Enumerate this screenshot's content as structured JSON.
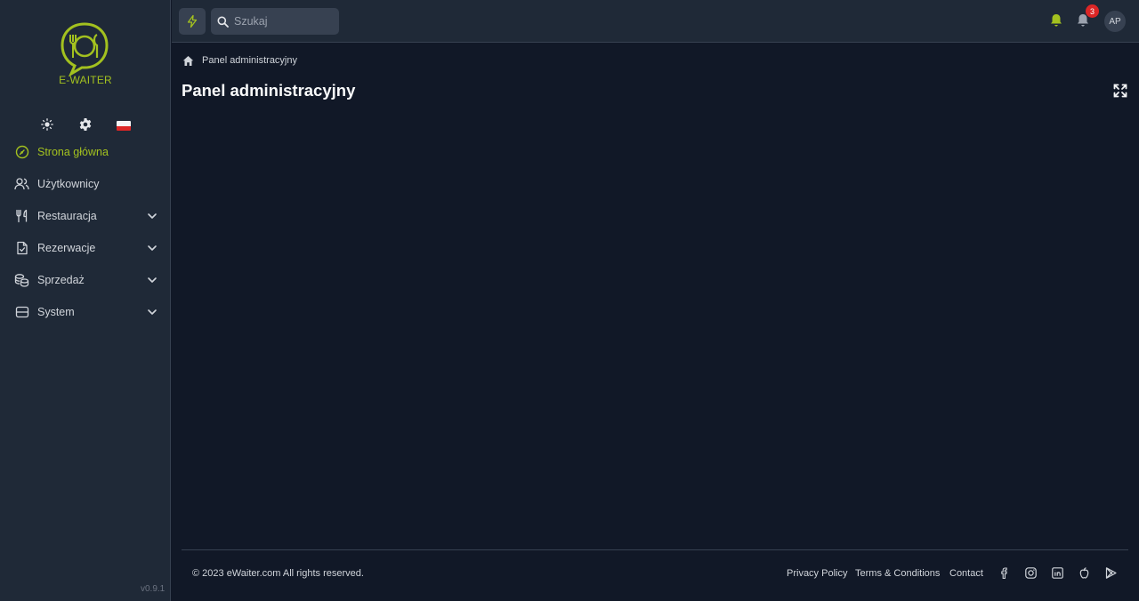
{
  "sidebar": {
    "logo_text": "E-WAITER",
    "quick_icons": [
      "sun-icon",
      "gear-icon",
      "poland-flag-icon"
    ],
    "items": [
      {
        "label": "Strona główna",
        "icon": "dashboard-icon",
        "active": true,
        "expandable": false
      },
      {
        "label": "Użytkownicy",
        "icon": "users-icon",
        "active": false,
        "expandable": false
      },
      {
        "label": "Restauracja",
        "icon": "utensils-icon",
        "active": false,
        "expandable": true
      },
      {
        "label": "Rezerwacje",
        "icon": "document-check-icon",
        "active": false,
        "expandable": true
      },
      {
        "label": "Sprzedaż",
        "icon": "coins-icon",
        "active": false,
        "expandable": true
      },
      {
        "label": "System",
        "icon": "server-icon",
        "active": false,
        "expandable": true
      }
    ],
    "version": "v0.9.1"
  },
  "topbar": {
    "search_placeholder": "Szukaj",
    "notification_count": "3",
    "avatar_initials": "AP"
  },
  "breadcrumb": {
    "current": "Panel administracyjny"
  },
  "main": {
    "title": "Panel administracyjny"
  },
  "footer": {
    "copyright": "© 2023 eWaiter.com All rights reserved.",
    "links": [
      "Privacy Policy",
      "Terms & Conditions",
      "Contact"
    ],
    "social_icons": [
      "facebook-icon",
      "instagram-icon",
      "linkedin-icon",
      "apple-icon",
      "google-play-icon"
    ]
  },
  "colors": {
    "accent": "#a3c11f",
    "sidebar_bg": "#1f2937",
    "main_bg": "#111827",
    "badge": "#dc2626"
  }
}
